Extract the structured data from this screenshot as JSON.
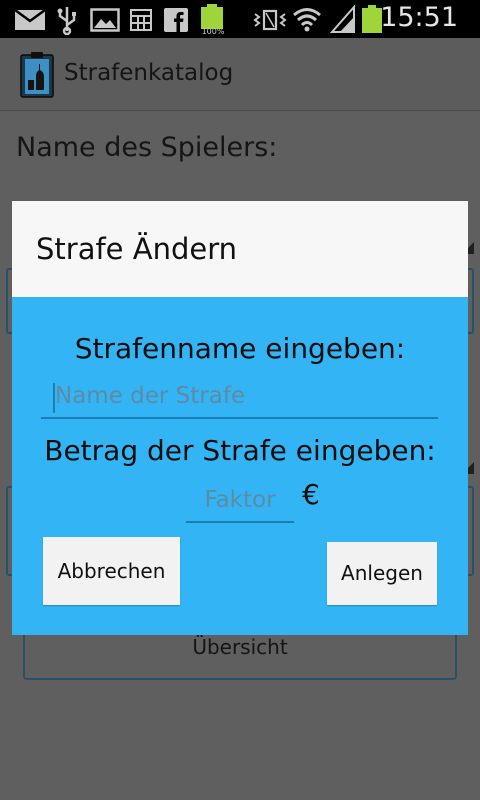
{
  "status_bar": {
    "time": "15:51",
    "battery_small_label": "100%",
    "icons": [
      "email-icon",
      "usb-icon",
      "gallery-icon",
      "calendar-icon",
      "facebook-icon",
      "battery-full-icon",
      "vibrate-icon",
      "wifi-icon",
      "signal-icon",
      "battery-icon"
    ]
  },
  "action_bar": {
    "title": "Strafenkatalog",
    "icon": "clipboard-bottle-icon"
  },
  "background": {
    "player_name_label": "Name des Spielers:",
    "overview_button": "Übersicht"
  },
  "dialog": {
    "title": "Strafe Ändern",
    "name_label": "Strafenname eingeben:",
    "name_placeholder": "Name der Strafe",
    "amount_label": "Betrag der Strafe eingeben:",
    "factor_placeholder": "Faktor",
    "currency": "€",
    "cancel_button": "Abbrechen",
    "create_button": "Anlegen"
  },
  "colors": {
    "dialog_body": "#33b5f5",
    "dialog_header": "#f7f7f7",
    "input_underline": "#1880b0",
    "battery_green": "#9fd53a"
  }
}
